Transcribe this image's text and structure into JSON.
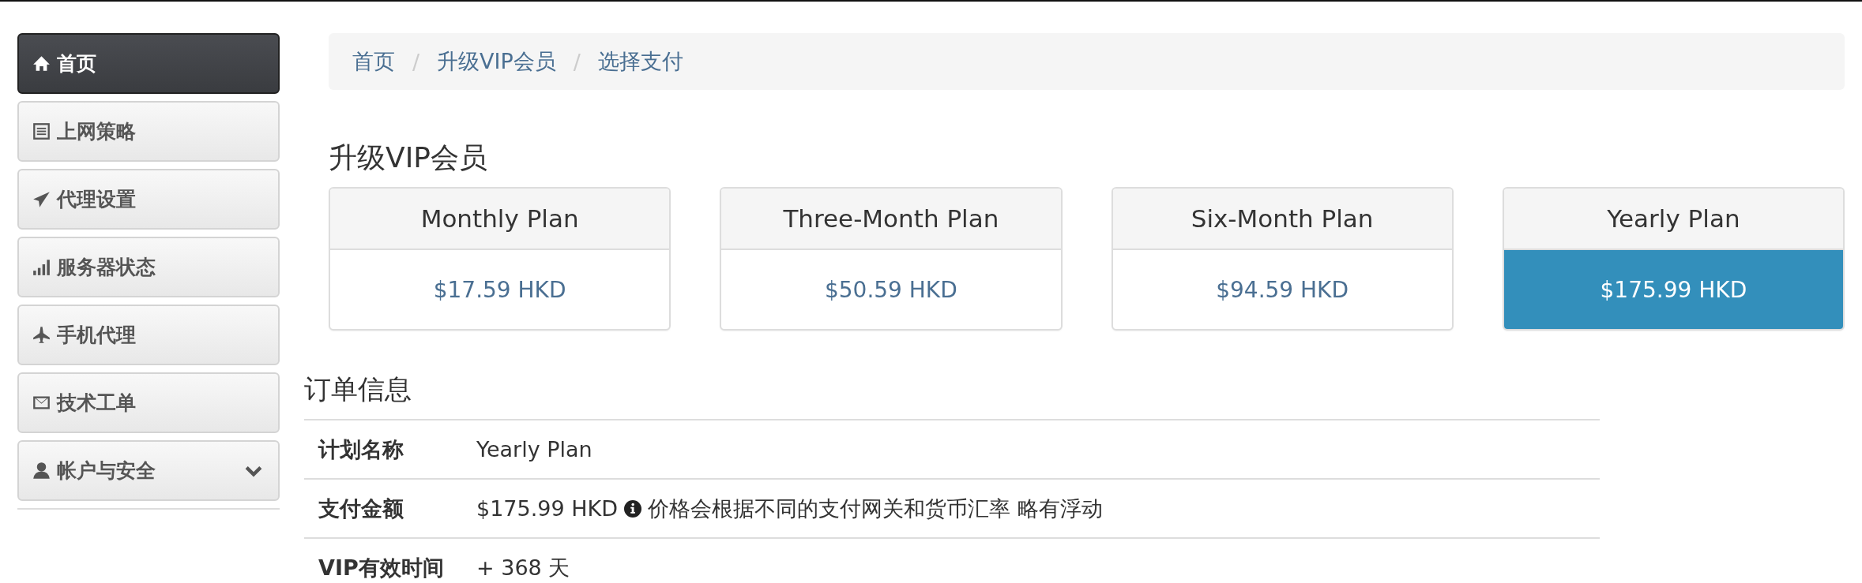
{
  "sidebar": {
    "items": [
      {
        "label": "首页",
        "selected": true,
        "expandable": false
      },
      {
        "label": "上网策略",
        "selected": false,
        "expandable": false
      },
      {
        "label": "代理设置",
        "selected": false,
        "expandable": false
      },
      {
        "label": "服务器状态",
        "selected": false,
        "expandable": false
      },
      {
        "label": "手机代理",
        "selected": false,
        "expandable": false
      },
      {
        "label": "技术工单",
        "selected": false,
        "expandable": false
      },
      {
        "label": "帐户与安全",
        "selected": false,
        "expandable": true
      }
    ]
  },
  "breadcrumb": [
    {
      "label": "首页"
    },
    {
      "separator": "/",
      "label": "升级VIP会员"
    },
    {
      "separator": "/",
      "label": "选择支付"
    }
  ],
  "plans": {
    "title": "升级VIP会员",
    "items": [
      {
        "name": "Monthly Plan",
        "price": "$17.59 HKD",
        "selected": false
      },
      {
        "name": "Three-Month Plan",
        "price": "$50.59 HKD",
        "selected": false
      },
      {
        "name": "Six-Month Plan",
        "price": "$94.59 HKD",
        "selected": false
      },
      {
        "name": "Yearly Plan",
        "price": "$175.99 HKD",
        "selected": true
      }
    ]
  },
  "order": {
    "title": "订单信息",
    "rows": [
      {
        "label": "计划名称",
        "value": "Yearly Plan"
      },
      {
        "label": "支付金额",
        "value": "$175.99 HKD",
        "note": "价格会根据不同的支付网关和货币汇率 略有浮动"
      },
      {
        "label": "VIP有效时间",
        "value": "+ 368 天"
      }
    ]
  }
}
